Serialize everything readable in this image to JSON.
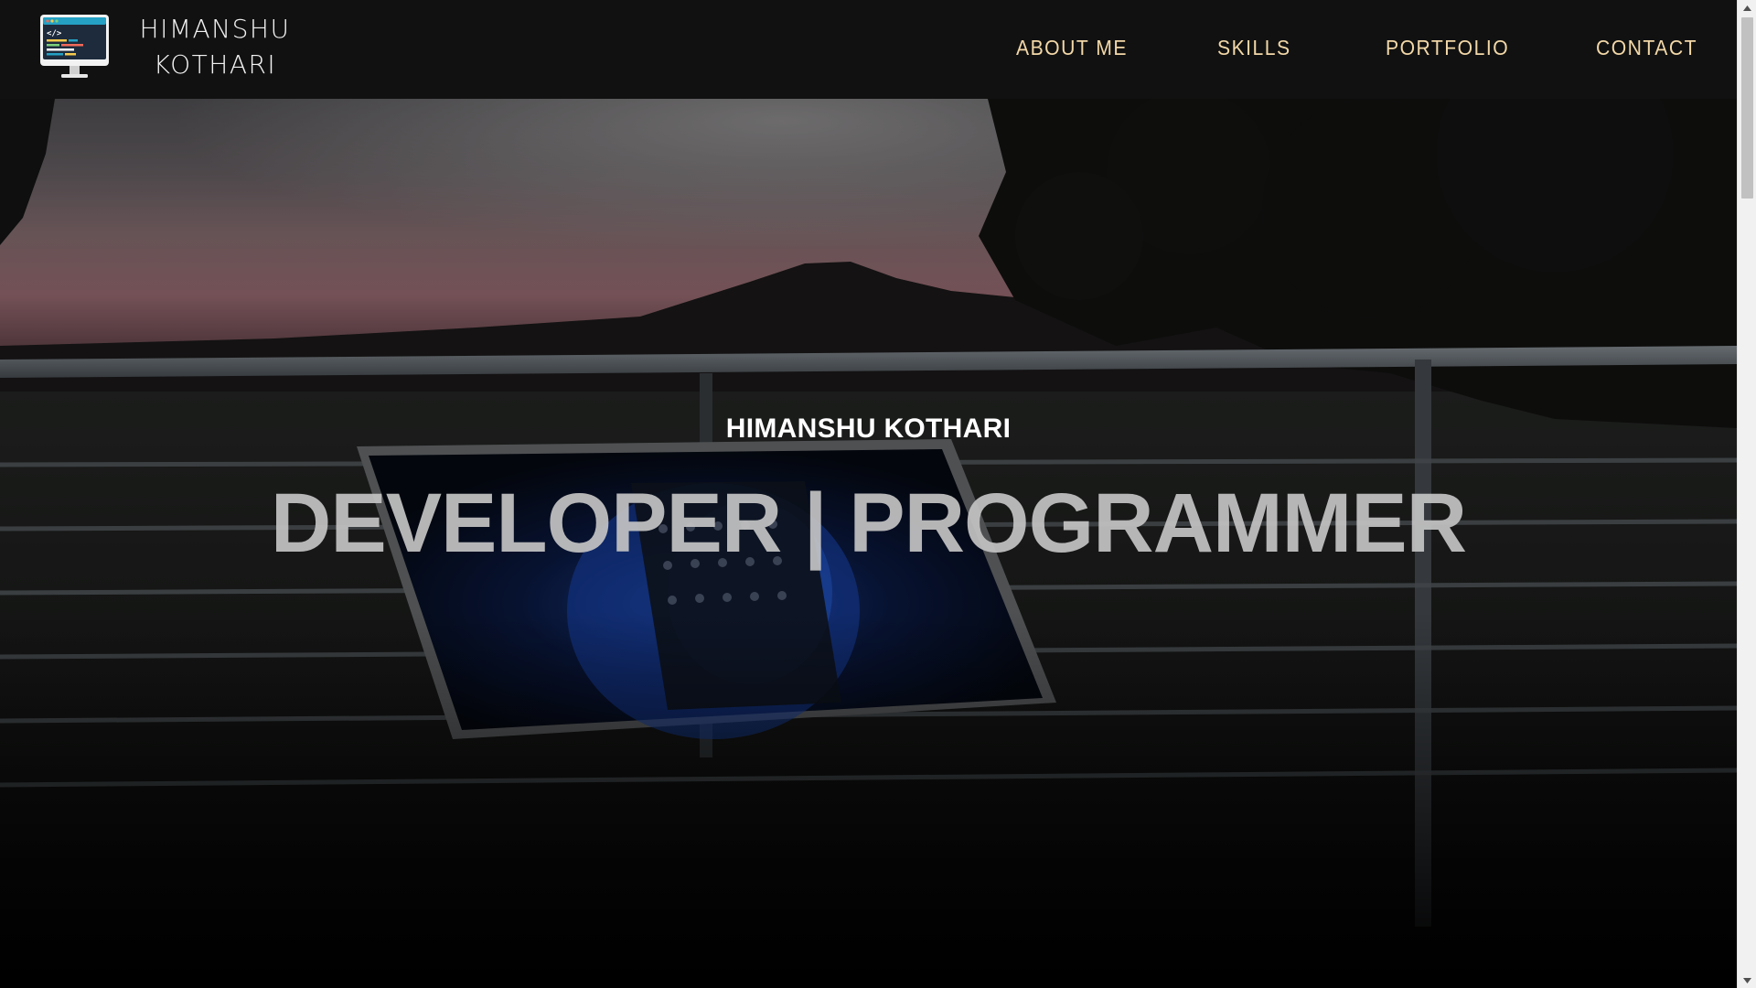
{
  "header": {
    "brand_line1": "HIMANSHU",
    "brand_line2": "KOTHARI",
    "logo_icon": "monitor-code-icon",
    "nav": {
      "about": "ABOUT ME",
      "skills": "SKILLS",
      "portfolio": "PORTFOLIO",
      "contact": "CONTACT"
    }
  },
  "hero": {
    "name": "HIMANSHU KOTHARI",
    "title": "DEVELOPER | PROGRAMMER"
  },
  "colors": {
    "navbar_bg": "#111111",
    "nav_link": "#f3d8a8",
    "hero_title": "#c4c4c4",
    "hero_name": "#ffffff"
  }
}
